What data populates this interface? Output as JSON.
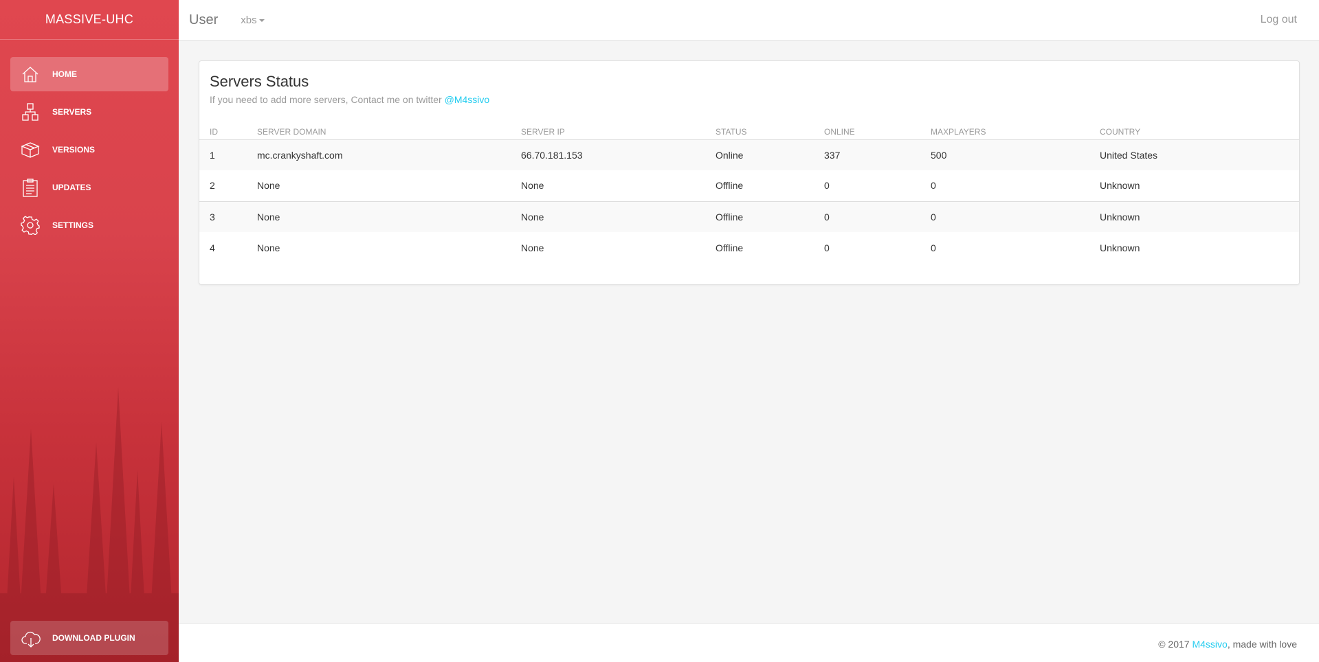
{
  "sidebar": {
    "brand": "MASSIVE-UHC",
    "items": [
      {
        "label": "HOME",
        "icon": "home-icon"
      },
      {
        "label": "SERVERS",
        "icon": "network-icon"
      },
      {
        "label": "VERSIONS",
        "icon": "box-icon"
      },
      {
        "label": "UPDATES",
        "icon": "clipboard-icon"
      },
      {
        "label": "SETTINGS",
        "icon": "gear-icon"
      }
    ],
    "active_item": "HOME",
    "download": {
      "label": "DOWNLOAD PLUGIN",
      "icon": "cloud-download-icon"
    }
  },
  "topbar": {
    "title": "User",
    "dropdown": "xbs",
    "logout": "Log out"
  },
  "card": {
    "title": "Servers Status",
    "subtitle": "If you need to add more servers, Contact me on twitter",
    "twitter": "@M4ssivo",
    "columns": [
      "ID",
      "SERVER DOMAIN",
      "SERVER IP",
      "STATUS",
      "ONLINE",
      "MAXPLAYERS",
      "COUNTRY"
    ],
    "rows": [
      [
        "1",
        "mc.crankyshaft.com",
        "66.70.181.153",
        "Online",
        "337",
        "500",
        "United States"
      ],
      [
        "2",
        "None",
        "None",
        "Offline",
        "0",
        "0",
        "Unknown"
      ],
      [
        "3",
        "None",
        "None",
        "Offline",
        "0",
        "0",
        "Unknown"
      ],
      [
        "4",
        "None",
        "None",
        "Offline",
        "0",
        "0",
        "Unknown"
      ]
    ]
  },
  "footer": {
    "prefix": "© 2017",
    "author": "M4ssivo",
    "suffix": ", made with love"
  },
  "colors": {
    "sidebar": "#d9434c",
    "accent": "#23ccef"
  }
}
